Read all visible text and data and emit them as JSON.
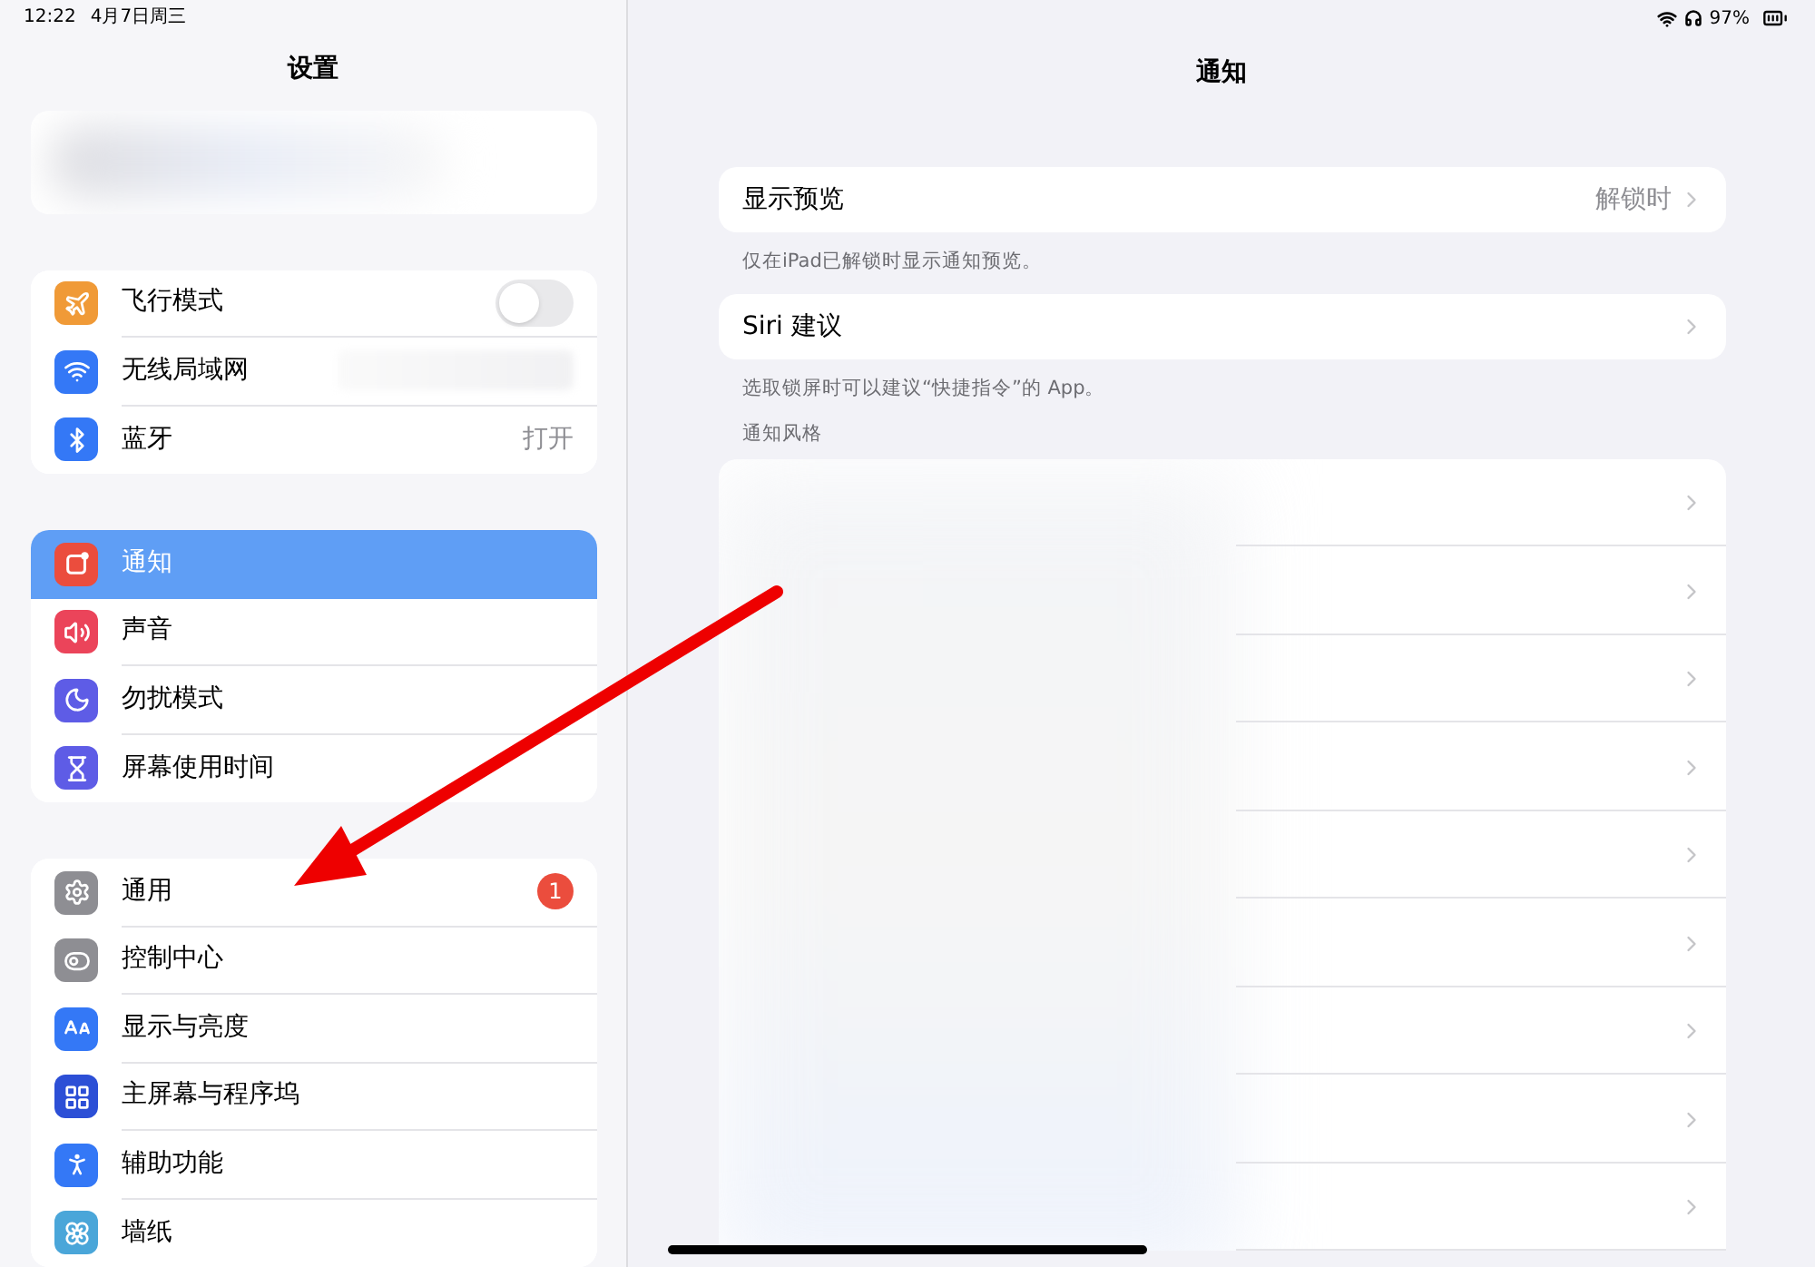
{
  "status_bar": {
    "time": "12:22",
    "date": "4月7日周三",
    "battery": "97%"
  },
  "sidebar": {
    "title": "设置",
    "groups": [
      {
        "items": [
          {
            "label": "飞行模式",
            "kind": "toggle",
            "on": false,
            "color": "#f09a37",
            "selected": false
          },
          {
            "label": "无线局域网",
            "kind": "blurred",
            "color": "#3478f6",
            "selected": false
          },
          {
            "label": "蓝牙",
            "kind": "value",
            "value": "打开",
            "color": "#3478f6",
            "selected": false
          }
        ]
      },
      {
        "items": [
          {
            "label": "通知",
            "kind": "plain",
            "color": "#eb4d3d",
            "selected": true
          },
          {
            "label": "声音",
            "kind": "plain",
            "color": "#eb445a",
            "selected": false
          },
          {
            "label": "勿扰模式",
            "kind": "plain",
            "color": "#5e5ce6",
            "selected": false
          },
          {
            "label": "屏幕使用时间",
            "kind": "plain",
            "color": "#5e5ce6",
            "selected": false
          }
        ]
      },
      {
        "items": [
          {
            "label": "通用",
            "kind": "badge",
            "badge": "1",
            "color": "#8e8e93",
            "selected": false
          },
          {
            "label": "控制中心",
            "kind": "plain",
            "color": "#8e8e93",
            "selected": false
          },
          {
            "label": "显示与亮度",
            "kind": "plain",
            "color": "#3478f6",
            "selected": false
          },
          {
            "label": "主屏幕与程序坞",
            "kind": "plain",
            "color": "#2c4fd6",
            "selected": false
          },
          {
            "label": "辅助功能",
            "kind": "plain",
            "color": "#3478f6",
            "selected": false
          },
          {
            "label": "墙纸",
            "kind": "plain",
            "color": "#4aa6d9",
            "selected": false
          }
        ]
      }
    ]
  },
  "detail": {
    "title": "通知",
    "sections": [
      {
        "label": "显示预览",
        "value": "解锁时",
        "footer": "仅在iPad已解锁时显示通知预览。"
      },
      {
        "label": "Siri 建议",
        "footer": "选取锁屏时可以建议“快捷指令”的 App。"
      }
    ],
    "app_list": {
      "header": "通知风格",
      "rows": [
        {
          "kind": "blurred"
        },
        {
          "kind": "blurred"
        },
        {
          "kind": "blurred"
        },
        {
          "kind": "blurred"
        },
        {
          "kind": "blurred"
        },
        {
          "kind": "blurred"
        },
        {
          "kind": "blurred"
        },
        {
          "kind": "blurred"
        },
        {
          "kind": "blurred"
        }
      ]
    }
  }
}
